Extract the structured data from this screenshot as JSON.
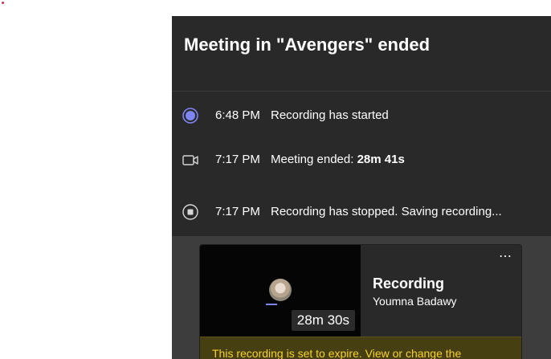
{
  "header": {
    "title": "Meeting in \"Avengers\" ended"
  },
  "events": [
    {
      "time": "6:48 PM",
      "message": "Recording has started",
      "icon": "recording-icon"
    },
    {
      "time": "7:17 PM",
      "message": "Meeting ended: ",
      "bold": "28m 41s",
      "icon": "video-camera-icon"
    },
    {
      "time": "7:17 PM",
      "message": "Recording has stopped. Saving recording...",
      "icon": "stop-icon"
    }
  ],
  "recording_card": {
    "title": "Recording",
    "owner": "Youmna Badawy",
    "duration": "28m 30s",
    "more_label": "⋯",
    "banner": "This recording is set to expire. View or change the"
  },
  "colors": {
    "panel": "#292929",
    "accent": "#7f85f5",
    "warning": "#f8d22a"
  }
}
